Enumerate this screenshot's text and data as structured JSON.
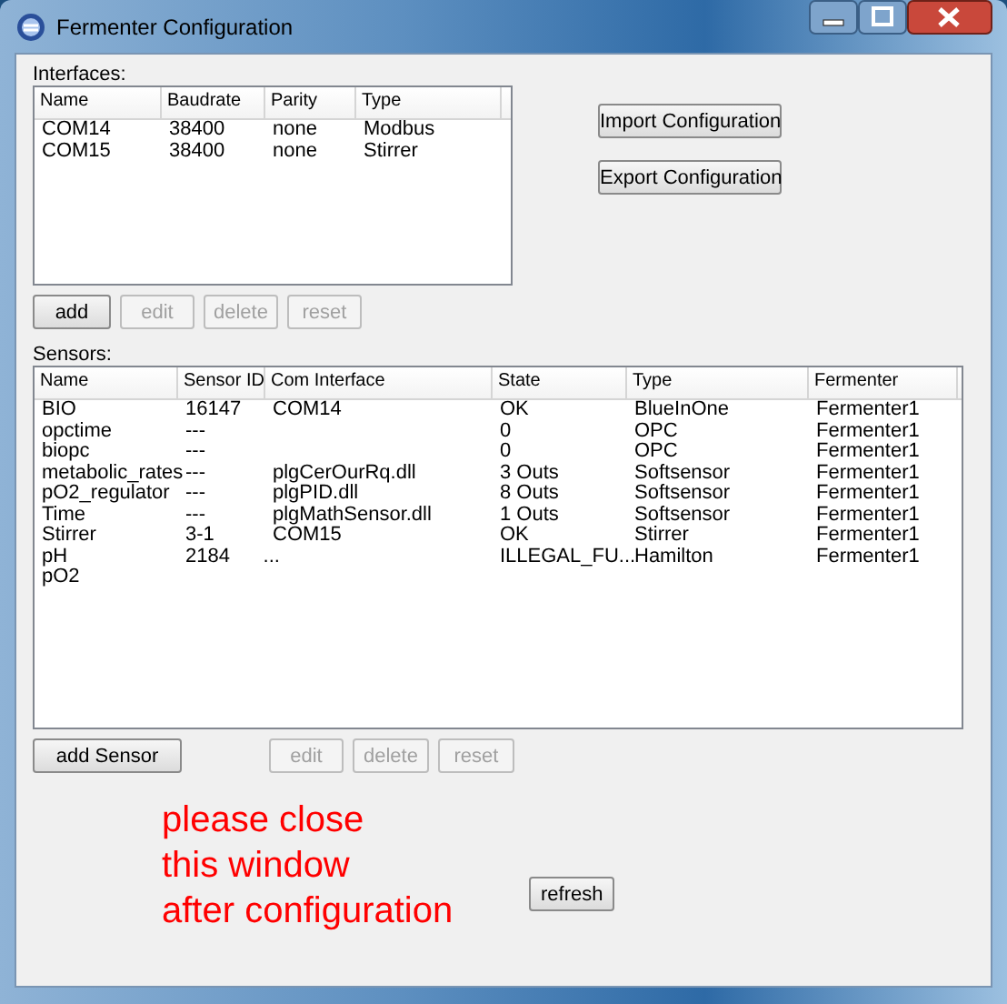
{
  "window": {
    "title": "Fermenter Configuration"
  },
  "interfaces": {
    "label": "Interfaces:",
    "columns": [
      "Name",
      "Baudrate",
      "Parity",
      "Type"
    ],
    "rows": [
      [
        "COM14",
        "38400",
        "none",
        "Modbus"
      ],
      [
        "COM15",
        "38400",
        "none",
        "Stirrer"
      ]
    ],
    "buttons": [
      {
        "label": "add",
        "disabled": false
      },
      {
        "label": "edit",
        "disabled": true
      },
      {
        "label": "delete",
        "disabled": true
      },
      {
        "label": "reset",
        "disabled": true
      }
    ]
  },
  "side_buttons": [
    {
      "label": "Import Configuration",
      "disabled": false
    },
    {
      "label": "Export Configuration",
      "disabled": false
    }
  ],
  "sensors": {
    "label": "Sensors:",
    "columns": [
      "Name",
      "Sensor ID",
      "Com Interface",
      "State",
      "Type",
      "Fermenter"
    ],
    "rows": [
      [
        "BIO",
        "16147",
        "COM14",
        "OK",
        "BlueInOne",
        "Fermenter1"
      ],
      [
        "opctime",
        "---",
        "",
        "0",
        "OPC",
        "Fermenter1"
      ],
      [
        "biopc",
        "---",
        "",
        "0",
        "OPC",
        "Fermenter1"
      ],
      [
        "metabolic_rates",
        "---",
        "plgCerOurRq.dll",
        "3 Outs",
        "Softsensor",
        "Fermenter1"
      ],
      [
        "pO2_regulator",
        "---",
        "plgPID.dll",
        "8 Outs",
        "Softsensor",
        "Fermenter1"
      ],
      [
        "Time",
        "---",
        "plgMathSensor.dll",
        "1 Outs",
        "Softsensor",
        "Fermenter1"
      ],
      [
        "Stirrer",
        "3-1",
        "COM15",
        "OK",
        "Stirrer",
        "Fermenter1"
      ],
      [
        "pH",
        "2184      ...",
        "",
        "ILLEGAL_FU...",
        "Hamilton",
        "Fermenter1"
      ],
      [
        "pO2",
        "",
        "",
        "",
        "",
        ""
      ]
    ],
    "buttons": [
      {
        "label": "add Sensor",
        "disabled": false
      },
      {
        "label": "edit",
        "disabled": true
      },
      {
        "label": "delete",
        "disabled": true
      },
      {
        "label": "reset",
        "disabled": true
      }
    ]
  },
  "note": "please close\nthis window\nafter configuration",
  "refresh_button": {
    "label": "refresh",
    "disabled": false
  }
}
